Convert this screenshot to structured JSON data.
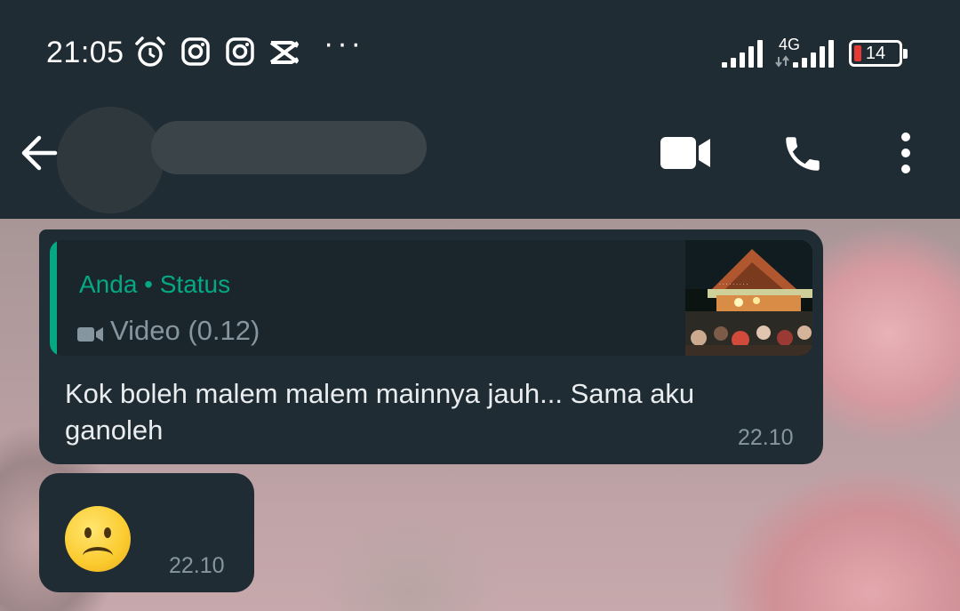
{
  "status_bar": {
    "time": "21:05",
    "network_label": "4G",
    "battery_level": "14",
    "battery_color": "#e53935",
    "icons": [
      "alarm-icon",
      "instagram-icon",
      "instagram-icon",
      "capcut-icon",
      "more-notifications-icon",
      "signal-icon",
      "signal-4g-icon",
      "battery-icon"
    ]
  },
  "app_bar": {
    "contact_name": "",
    "back_icon": "arrow-left-icon",
    "video_call_icon": "video-camera-icon",
    "voice_call_icon": "phone-icon",
    "menu_icon": "more-vertical-icon",
    "background": "#1f2c34"
  },
  "messages": [
    {
      "quoted": {
        "author": "Anda • Status",
        "media_label": "Video (0.12)",
        "media_icon": "video-camera-icon",
        "accent": "#06a884"
      },
      "text": "Kok boleh malem malem mainnya jauh... Sama aku ganoleh",
      "time": "22.10"
    },
    {
      "emoji": "☹️",
      "time": "22.10"
    }
  ],
  "colors": {
    "bubble": "#202c33",
    "text": "#e9edef",
    "secondary_text": "#8696a0"
  }
}
